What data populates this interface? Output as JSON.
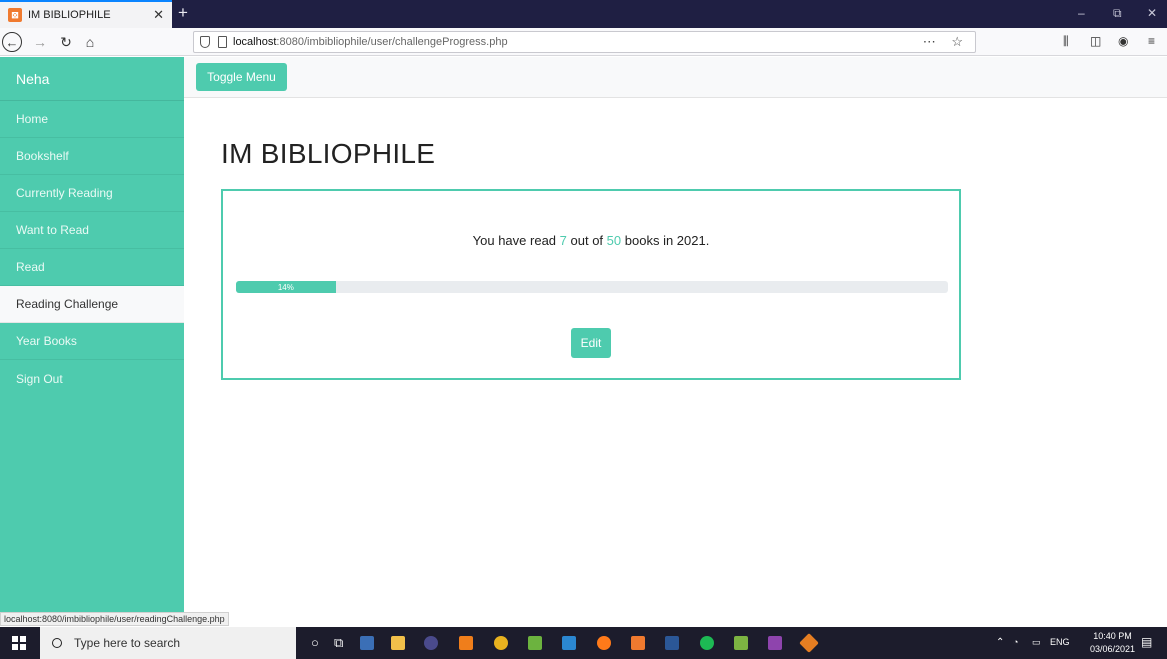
{
  "browser": {
    "tab_title": "IM BIBLIOPHILE",
    "url_host": "localhost",
    "url_path": ":8080/imbibliophile/user/challengeProgress.php",
    "status_url": "localhost:8080/imbibliophile/user/readingChallenge.php"
  },
  "sidebar": {
    "brand": "Neha",
    "items": [
      {
        "label": "Home"
      },
      {
        "label": "Bookshelf"
      },
      {
        "label": "Currently Reading"
      },
      {
        "label": "Want to Read"
      },
      {
        "label": "Read"
      },
      {
        "label": "Reading Challenge"
      },
      {
        "label": "Year Books"
      },
      {
        "label": "Sign Out"
      }
    ],
    "active_item": "Reading Challenge"
  },
  "topbar": {
    "toggle_label": "Toggle Menu"
  },
  "main": {
    "title": "IM BIBLIOPHILE",
    "summary_prefix": "You have read",
    "books_read": "7",
    "summary_mid": "out of",
    "books_goal": "50",
    "summary_suffix": "books in 2021.",
    "progress_label": "14%",
    "progress_fraction": 0.14,
    "edit_label": "Edit"
  },
  "taskbar": {
    "search_placeholder": "Type here to search",
    "lang": "ENG",
    "time": "10:40 PM",
    "date": "03/06/2021",
    "notification_count": "4"
  },
  "colors": {
    "accent": "#4ecbae",
    "progress_track": "#e9ecef"
  }
}
